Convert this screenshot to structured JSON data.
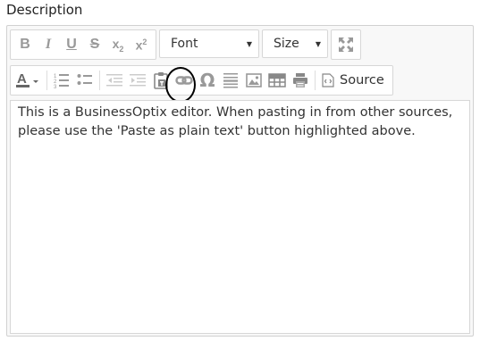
{
  "field_label": "Description",
  "toolbar": {
    "row1": {
      "buttons": [
        {
          "name": "bold-button",
          "icon": "bold-icon",
          "glyph": "B"
        },
        {
          "name": "italic-button",
          "icon": "italic-icon",
          "glyph": "I"
        },
        {
          "name": "underline-button",
          "icon": "underline-icon",
          "glyph": "U"
        },
        {
          "name": "strikethrough-button",
          "icon": "strikethrough-icon",
          "glyph": "S"
        },
        {
          "name": "subscript-button",
          "icon": "subscript-icon",
          "glyph": "x₂"
        },
        {
          "name": "superscript-button",
          "icon": "superscript-icon",
          "glyph": "x²"
        }
      ],
      "font_label": "Font",
      "size_label": "Size",
      "maximize_icon": "maximize-icon"
    },
    "row2": {
      "text_color_icon": "text-color-icon",
      "numbered_list_icon": "numbered-list-icon",
      "bulleted_list_icon": "bulleted-list-icon",
      "outdent_icon": "outdent-icon",
      "indent_icon": "indent-icon",
      "paste_text_icon": "paste-as-plain-text-icon",
      "link_icon": "link-icon",
      "special_char_icon": "omega-icon",
      "horizontal_line_icon": "horizontal-line-icon",
      "image_icon": "image-icon",
      "table_icon": "table-icon",
      "print_icon": "print-icon",
      "source_label": "Source"
    }
  },
  "editor_text": "This is a BusinessOptix editor. When pasting in from other sources, please use the 'Paste as plain text' button highlighted above.",
  "colors": {
    "icon": "#999999",
    "icon_dark": "#666666",
    "border": "#d7d7d7",
    "highlight_ring": "#000000"
  }
}
